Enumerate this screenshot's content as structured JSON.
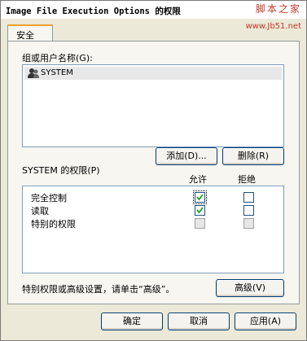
{
  "window": {
    "title": "Image File Execution Options 的权限"
  },
  "watermark": {
    "site": "脚本之家",
    "url": "www.Jb51.net"
  },
  "tabs": [
    {
      "label": "安全"
    }
  ],
  "groups": {
    "label": "组或用户名称(G):",
    "users": [
      {
        "name": "SYSTEM",
        "icon": "user-group-icon"
      }
    ]
  },
  "buttons": {
    "add": "添加(D)...",
    "remove": "删除(R)",
    "advanced": "高级(V)"
  },
  "permissions": {
    "label": "SYSTEM 的权限(P)",
    "col_allow": "允许",
    "col_deny": "拒绝",
    "rows": [
      {
        "name": "完全控制",
        "allow": true,
        "deny": false,
        "enabled": true
      },
      {
        "name": "读取",
        "allow": true,
        "deny": false,
        "enabled": true
      },
      {
        "name": "特别的权限",
        "allow": false,
        "deny": false,
        "enabled": false
      }
    ]
  },
  "advanced_note": "特别权限或高级设置，请单击“高级”。",
  "footer": {
    "ok": "确定",
    "cancel": "取消",
    "apply": "应用(A)"
  },
  "colors": {
    "tab_accent": "#f0a030",
    "watermark": "#c0392b",
    "dialog_bg": "#ece9d8"
  }
}
